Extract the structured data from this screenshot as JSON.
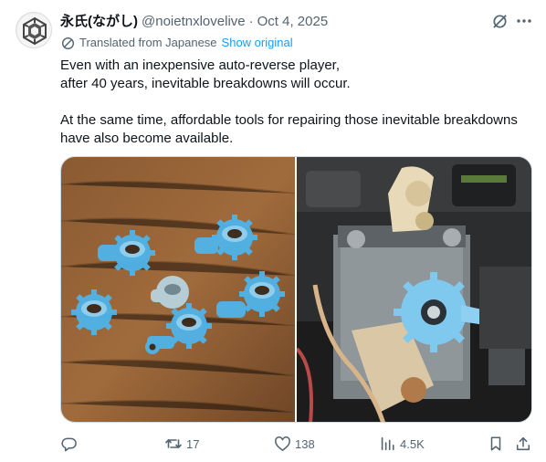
{
  "author": {
    "display_name": "永氏(ながし)",
    "handle": "@noietnxlovelive",
    "separator": "·",
    "date": "Oct 4, 2025",
    "avatar_icon": "geometric-logo-icon"
  },
  "header_icons": {
    "grok": "grok-icon",
    "more": "more-icon"
  },
  "translation": {
    "icon": "translate-icon",
    "text": "Translated from Japanese",
    "show_original": "Show original"
  },
  "body": {
    "line1": "Even with an inexpensive auto-reverse player,",
    "line2": "after 40 years, inevitable breakdowns will occur.",
    "line3": "At the same time, affordable tools for repairing those inevitable breakdowns",
    "line4": "have also become available."
  },
  "media": {
    "photo_left": "3D-printed blue gears on wooden table",
    "photo_right": "Blue gear installed in cassette mechanism"
  },
  "actions": {
    "reply": {
      "icon": "reply-icon",
      "count": ""
    },
    "retweet": {
      "icon": "retweet-icon",
      "count": "17"
    },
    "like": {
      "icon": "heart-icon",
      "count": "138"
    },
    "views": {
      "icon": "views-icon",
      "count": "4.5K"
    },
    "bookmark": {
      "icon": "bookmark-icon"
    },
    "share": {
      "icon": "share-icon"
    }
  },
  "colors": {
    "text": "#0f1419",
    "secondary": "#536471",
    "link": "#1d9bf0",
    "border": "#cfd9de",
    "gear_blue": "#4fb4ea"
  }
}
